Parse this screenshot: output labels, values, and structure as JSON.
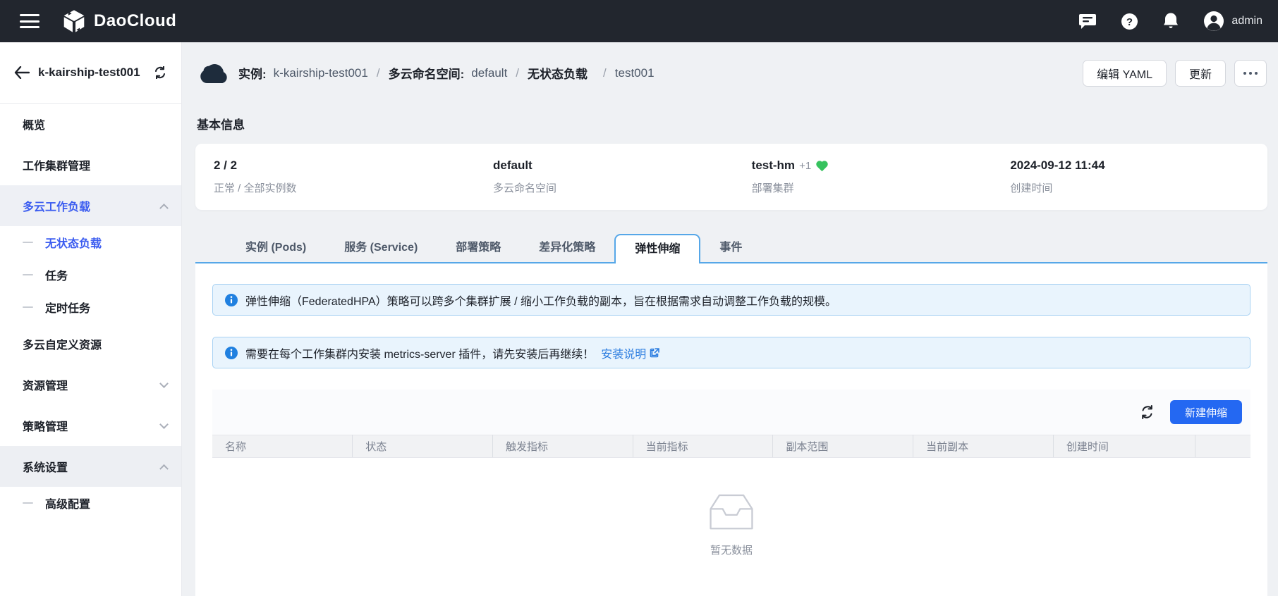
{
  "topbar": {
    "brand": "DaoCloud",
    "user": "admin"
  },
  "sidebar": {
    "title": "k-kairship-test001",
    "items": [
      {
        "label": "概览"
      },
      {
        "label": "工作集群管理"
      },
      {
        "label": "多云工作负载"
      },
      {
        "label": "无状态负载"
      },
      {
        "label": "任务"
      },
      {
        "label": "定时任务"
      },
      {
        "label": "多云自定义资源"
      },
      {
        "label": "资源管理"
      },
      {
        "label": "策略管理"
      },
      {
        "label": "系统设置"
      },
      {
        "label": "高级配置"
      }
    ]
  },
  "header": {
    "breadcrumb": [
      {
        "text": "实例:"
      },
      {
        "text": "k-kairship-test001"
      },
      {
        "text": "/"
      },
      {
        "text": "多云命名空间:"
      },
      {
        "text": "default"
      },
      {
        "text": "/"
      },
      {
        "text": "无状态负载"
      },
      {
        "text": "/"
      },
      {
        "text": "test001"
      }
    ],
    "actions": {
      "edit_yaml": "编辑 YAML",
      "update": "更新"
    }
  },
  "basic_info": {
    "title": "基本信息",
    "stats": [
      {
        "value": "2 / 2",
        "label": "正常 / 全部实例数"
      },
      {
        "value": "default",
        "label": "多云命名空间"
      },
      {
        "value": "test-hm",
        "extra": "+1",
        "label": "部署集群"
      },
      {
        "value": "2024-09-12 11:44",
        "label": "创建时间"
      }
    ]
  },
  "tabs": [
    {
      "label": "实例 (Pods)"
    },
    {
      "label": "服务 (Service)"
    },
    {
      "label": "部署策略"
    },
    {
      "label": "差异化策略"
    },
    {
      "label": "弹性伸缩",
      "active": true
    },
    {
      "label": "事件"
    }
  ],
  "alerts": [
    {
      "text": "弹性伸缩（FederatedHPA）策略可以跨多个集群扩展 / 缩小工作负载的副本，旨在根据需求自动调整工作负载的规模。"
    },
    {
      "text": "需要在每个工作集群内安装 metrics-server 插件，请先安装后再继续！",
      "link": "安装说明"
    }
  ],
  "toolbar": {
    "create": "新建伸缩"
  },
  "table": {
    "columns": [
      "名称",
      "状态",
      "触发指标",
      "当前指标",
      "副本范围",
      "当前副本",
      "创建时间"
    ],
    "empty": "暂无数据"
  },
  "icons": {
    "menu": "hamburger-icon",
    "brand": "daocloud-cube-icon",
    "messages": "chat-bubble-icon",
    "help": "question-circle-icon",
    "notifications": "bell-icon",
    "user": "avatar-icon",
    "back": "arrow-left-icon",
    "sync": "refresh-icon",
    "breadcrumb": "cloud-icon",
    "alert": "info-circle-icon",
    "link": "external-link-icon",
    "health": "heart-icon",
    "empty": "inbox-icon"
  },
  "colors": {
    "topbar_bg": "#22262e",
    "primary": "#2468f2",
    "sidebar_active": "#3b5cf0",
    "alert_bg": "#e9f4fd",
    "alert_border": "#a8d2f3",
    "tab_border": "#56a7e8",
    "link": "#2b7ce0",
    "heart_green": "#36c25e",
    "page_bg": "#eff1f4"
  }
}
